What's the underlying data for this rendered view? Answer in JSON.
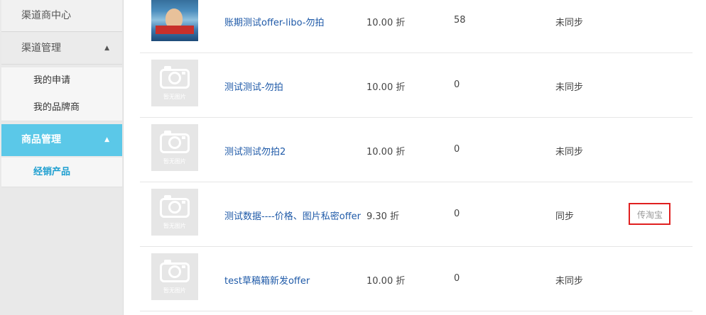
{
  "sidebar": {
    "top_item": "渠道商中心",
    "group_channel": {
      "label": "渠道管理",
      "caret": "▲"
    },
    "channel_items": [
      "我的申请",
      "我的品牌商"
    ],
    "group_goods": {
      "label": "商品管理",
      "caret": "▲"
    },
    "goods_items": [
      "经销产品"
    ]
  },
  "products": [
    {
      "name": "账期测试offer-libo-勿拍",
      "price": "10.00 折",
      "stock": "58",
      "sync": "未同步",
      "thumb": "photo",
      "thumb_text": ""
    },
    {
      "name": "测试测试-勿拍",
      "price": "10.00 折",
      "stock": "0",
      "sync": "未同步",
      "thumb": "placeholder",
      "thumb_text": "暂无图片"
    },
    {
      "name": "测试测试勿拍2",
      "price": "10.00 折",
      "stock": "0",
      "sync": "未同步",
      "thumb": "placeholder",
      "thumb_text": "暂无图片"
    },
    {
      "name": "测试数据----价格、图片私密offer",
      "price": "9.30 折",
      "stock": "0",
      "sync": "同步",
      "thumb": "placeholder",
      "thumb_text": "暂无图片",
      "action": "传淘宝"
    },
    {
      "name": "test草稿箱新发offer",
      "price": "10.00 折",
      "stock": "0",
      "sync": "未同步",
      "thumb": "placeholder",
      "thumb_text": "暂无图片"
    }
  ],
  "colors": {
    "active_nav": "#5bc8e8",
    "link": "#1f5aa8",
    "highlight_border": "#e02020"
  }
}
